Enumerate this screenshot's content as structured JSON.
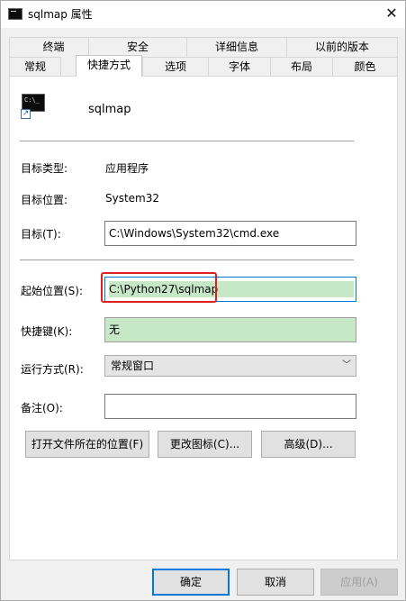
{
  "window": {
    "title": "sqlmap 属性",
    "close_glyph": "✕"
  },
  "tabs_row1": [
    "终端",
    "安全",
    "详细信息",
    "以前的版本"
  ],
  "tabs_row2": [
    "常规",
    "快捷方式",
    "选项",
    "字体",
    "布局",
    "颜色"
  ],
  "header": {
    "icon_glyph": "C:\\_",
    "shortcut_name": "sqlmap"
  },
  "fields": {
    "target_type_label": "目标类型:",
    "target_type_value": "应用程序",
    "target_location_label": "目标位置:",
    "target_location_value": "System32",
    "target_label": "目标(T):",
    "target_value": "C:\\Windows\\System32\\cmd.exe",
    "start_in_label": "起始位置(S):",
    "start_in_value": "C:\\Python27\\sqlmap",
    "hotkey_label": "快捷键(K):",
    "hotkey_value": "无",
    "run_label": "运行方式(R):",
    "run_value": "常规窗口",
    "comment_label": "备注(O):",
    "comment_value": ""
  },
  "buttons": {
    "open_location": "打开文件所在的位置(F)",
    "change_icon": "更改图标(C)...",
    "advanced": "高级(D)...",
    "ok": "确定",
    "cancel": "取消",
    "apply": "应用(A)"
  },
  "colors": {
    "highlight": "#c7e8c7",
    "annotation": "#e0201c",
    "focus": "#0078d7"
  }
}
